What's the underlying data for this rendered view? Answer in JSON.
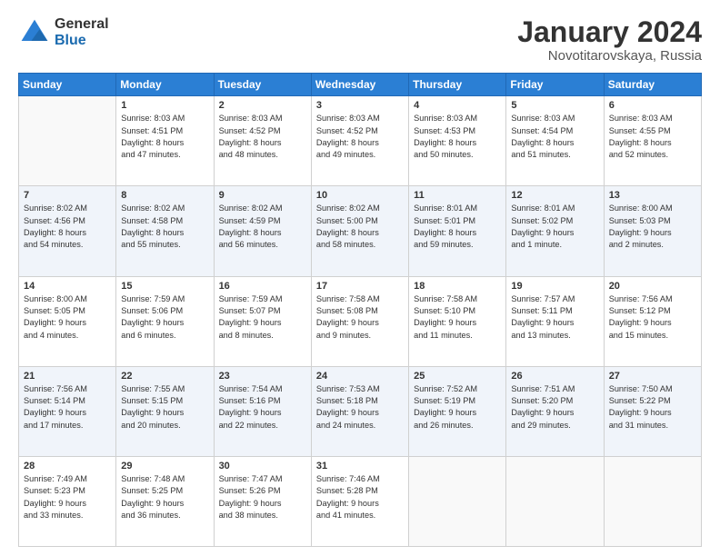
{
  "logo": {
    "general": "General",
    "blue": "Blue"
  },
  "header": {
    "month": "January 2024",
    "location": "Novotitarovskaya, Russia"
  },
  "weekdays": [
    "Sunday",
    "Monday",
    "Tuesday",
    "Wednesday",
    "Thursday",
    "Friday",
    "Saturday"
  ],
  "weeks": [
    [
      {
        "day": "",
        "info": ""
      },
      {
        "day": "1",
        "info": "Sunrise: 8:03 AM\nSunset: 4:51 PM\nDaylight: 8 hours\nand 47 minutes."
      },
      {
        "day": "2",
        "info": "Sunrise: 8:03 AM\nSunset: 4:52 PM\nDaylight: 8 hours\nand 48 minutes."
      },
      {
        "day": "3",
        "info": "Sunrise: 8:03 AM\nSunset: 4:52 PM\nDaylight: 8 hours\nand 49 minutes."
      },
      {
        "day": "4",
        "info": "Sunrise: 8:03 AM\nSunset: 4:53 PM\nDaylight: 8 hours\nand 50 minutes."
      },
      {
        "day": "5",
        "info": "Sunrise: 8:03 AM\nSunset: 4:54 PM\nDaylight: 8 hours\nand 51 minutes."
      },
      {
        "day": "6",
        "info": "Sunrise: 8:03 AM\nSunset: 4:55 PM\nDaylight: 8 hours\nand 52 minutes."
      }
    ],
    [
      {
        "day": "7",
        "info": "Sunrise: 8:02 AM\nSunset: 4:56 PM\nDaylight: 8 hours\nand 54 minutes."
      },
      {
        "day": "8",
        "info": "Sunrise: 8:02 AM\nSunset: 4:58 PM\nDaylight: 8 hours\nand 55 minutes."
      },
      {
        "day": "9",
        "info": "Sunrise: 8:02 AM\nSunset: 4:59 PM\nDaylight: 8 hours\nand 56 minutes."
      },
      {
        "day": "10",
        "info": "Sunrise: 8:02 AM\nSunset: 5:00 PM\nDaylight: 8 hours\nand 58 minutes."
      },
      {
        "day": "11",
        "info": "Sunrise: 8:01 AM\nSunset: 5:01 PM\nDaylight: 8 hours\nand 59 minutes."
      },
      {
        "day": "12",
        "info": "Sunrise: 8:01 AM\nSunset: 5:02 PM\nDaylight: 9 hours\nand 1 minute."
      },
      {
        "day": "13",
        "info": "Sunrise: 8:00 AM\nSunset: 5:03 PM\nDaylight: 9 hours\nand 2 minutes."
      }
    ],
    [
      {
        "day": "14",
        "info": "Sunrise: 8:00 AM\nSunset: 5:05 PM\nDaylight: 9 hours\nand 4 minutes."
      },
      {
        "day": "15",
        "info": "Sunrise: 7:59 AM\nSunset: 5:06 PM\nDaylight: 9 hours\nand 6 minutes."
      },
      {
        "day": "16",
        "info": "Sunrise: 7:59 AM\nSunset: 5:07 PM\nDaylight: 9 hours\nand 8 minutes."
      },
      {
        "day": "17",
        "info": "Sunrise: 7:58 AM\nSunset: 5:08 PM\nDaylight: 9 hours\nand 9 minutes."
      },
      {
        "day": "18",
        "info": "Sunrise: 7:58 AM\nSunset: 5:10 PM\nDaylight: 9 hours\nand 11 minutes."
      },
      {
        "day": "19",
        "info": "Sunrise: 7:57 AM\nSunset: 5:11 PM\nDaylight: 9 hours\nand 13 minutes."
      },
      {
        "day": "20",
        "info": "Sunrise: 7:56 AM\nSunset: 5:12 PM\nDaylight: 9 hours\nand 15 minutes."
      }
    ],
    [
      {
        "day": "21",
        "info": "Sunrise: 7:56 AM\nSunset: 5:14 PM\nDaylight: 9 hours\nand 17 minutes."
      },
      {
        "day": "22",
        "info": "Sunrise: 7:55 AM\nSunset: 5:15 PM\nDaylight: 9 hours\nand 20 minutes."
      },
      {
        "day": "23",
        "info": "Sunrise: 7:54 AM\nSunset: 5:16 PM\nDaylight: 9 hours\nand 22 minutes."
      },
      {
        "day": "24",
        "info": "Sunrise: 7:53 AM\nSunset: 5:18 PM\nDaylight: 9 hours\nand 24 minutes."
      },
      {
        "day": "25",
        "info": "Sunrise: 7:52 AM\nSunset: 5:19 PM\nDaylight: 9 hours\nand 26 minutes."
      },
      {
        "day": "26",
        "info": "Sunrise: 7:51 AM\nSunset: 5:20 PM\nDaylight: 9 hours\nand 29 minutes."
      },
      {
        "day": "27",
        "info": "Sunrise: 7:50 AM\nSunset: 5:22 PM\nDaylight: 9 hours\nand 31 minutes."
      }
    ],
    [
      {
        "day": "28",
        "info": "Sunrise: 7:49 AM\nSunset: 5:23 PM\nDaylight: 9 hours\nand 33 minutes."
      },
      {
        "day": "29",
        "info": "Sunrise: 7:48 AM\nSunset: 5:25 PM\nDaylight: 9 hours\nand 36 minutes."
      },
      {
        "day": "30",
        "info": "Sunrise: 7:47 AM\nSunset: 5:26 PM\nDaylight: 9 hours\nand 38 minutes."
      },
      {
        "day": "31",
        "info": "Sunrise: 7:46 AM\nSunset: 5:28 PM\nDaylight: 9 hours\nand 41 minutes."
      },
      {
        "day": "",
        "info": ""
      },
      {
        "day": "",
        "info": ""
      },
      {
        "day": "",
        "info": ""
      }
    ]
  ]
}
